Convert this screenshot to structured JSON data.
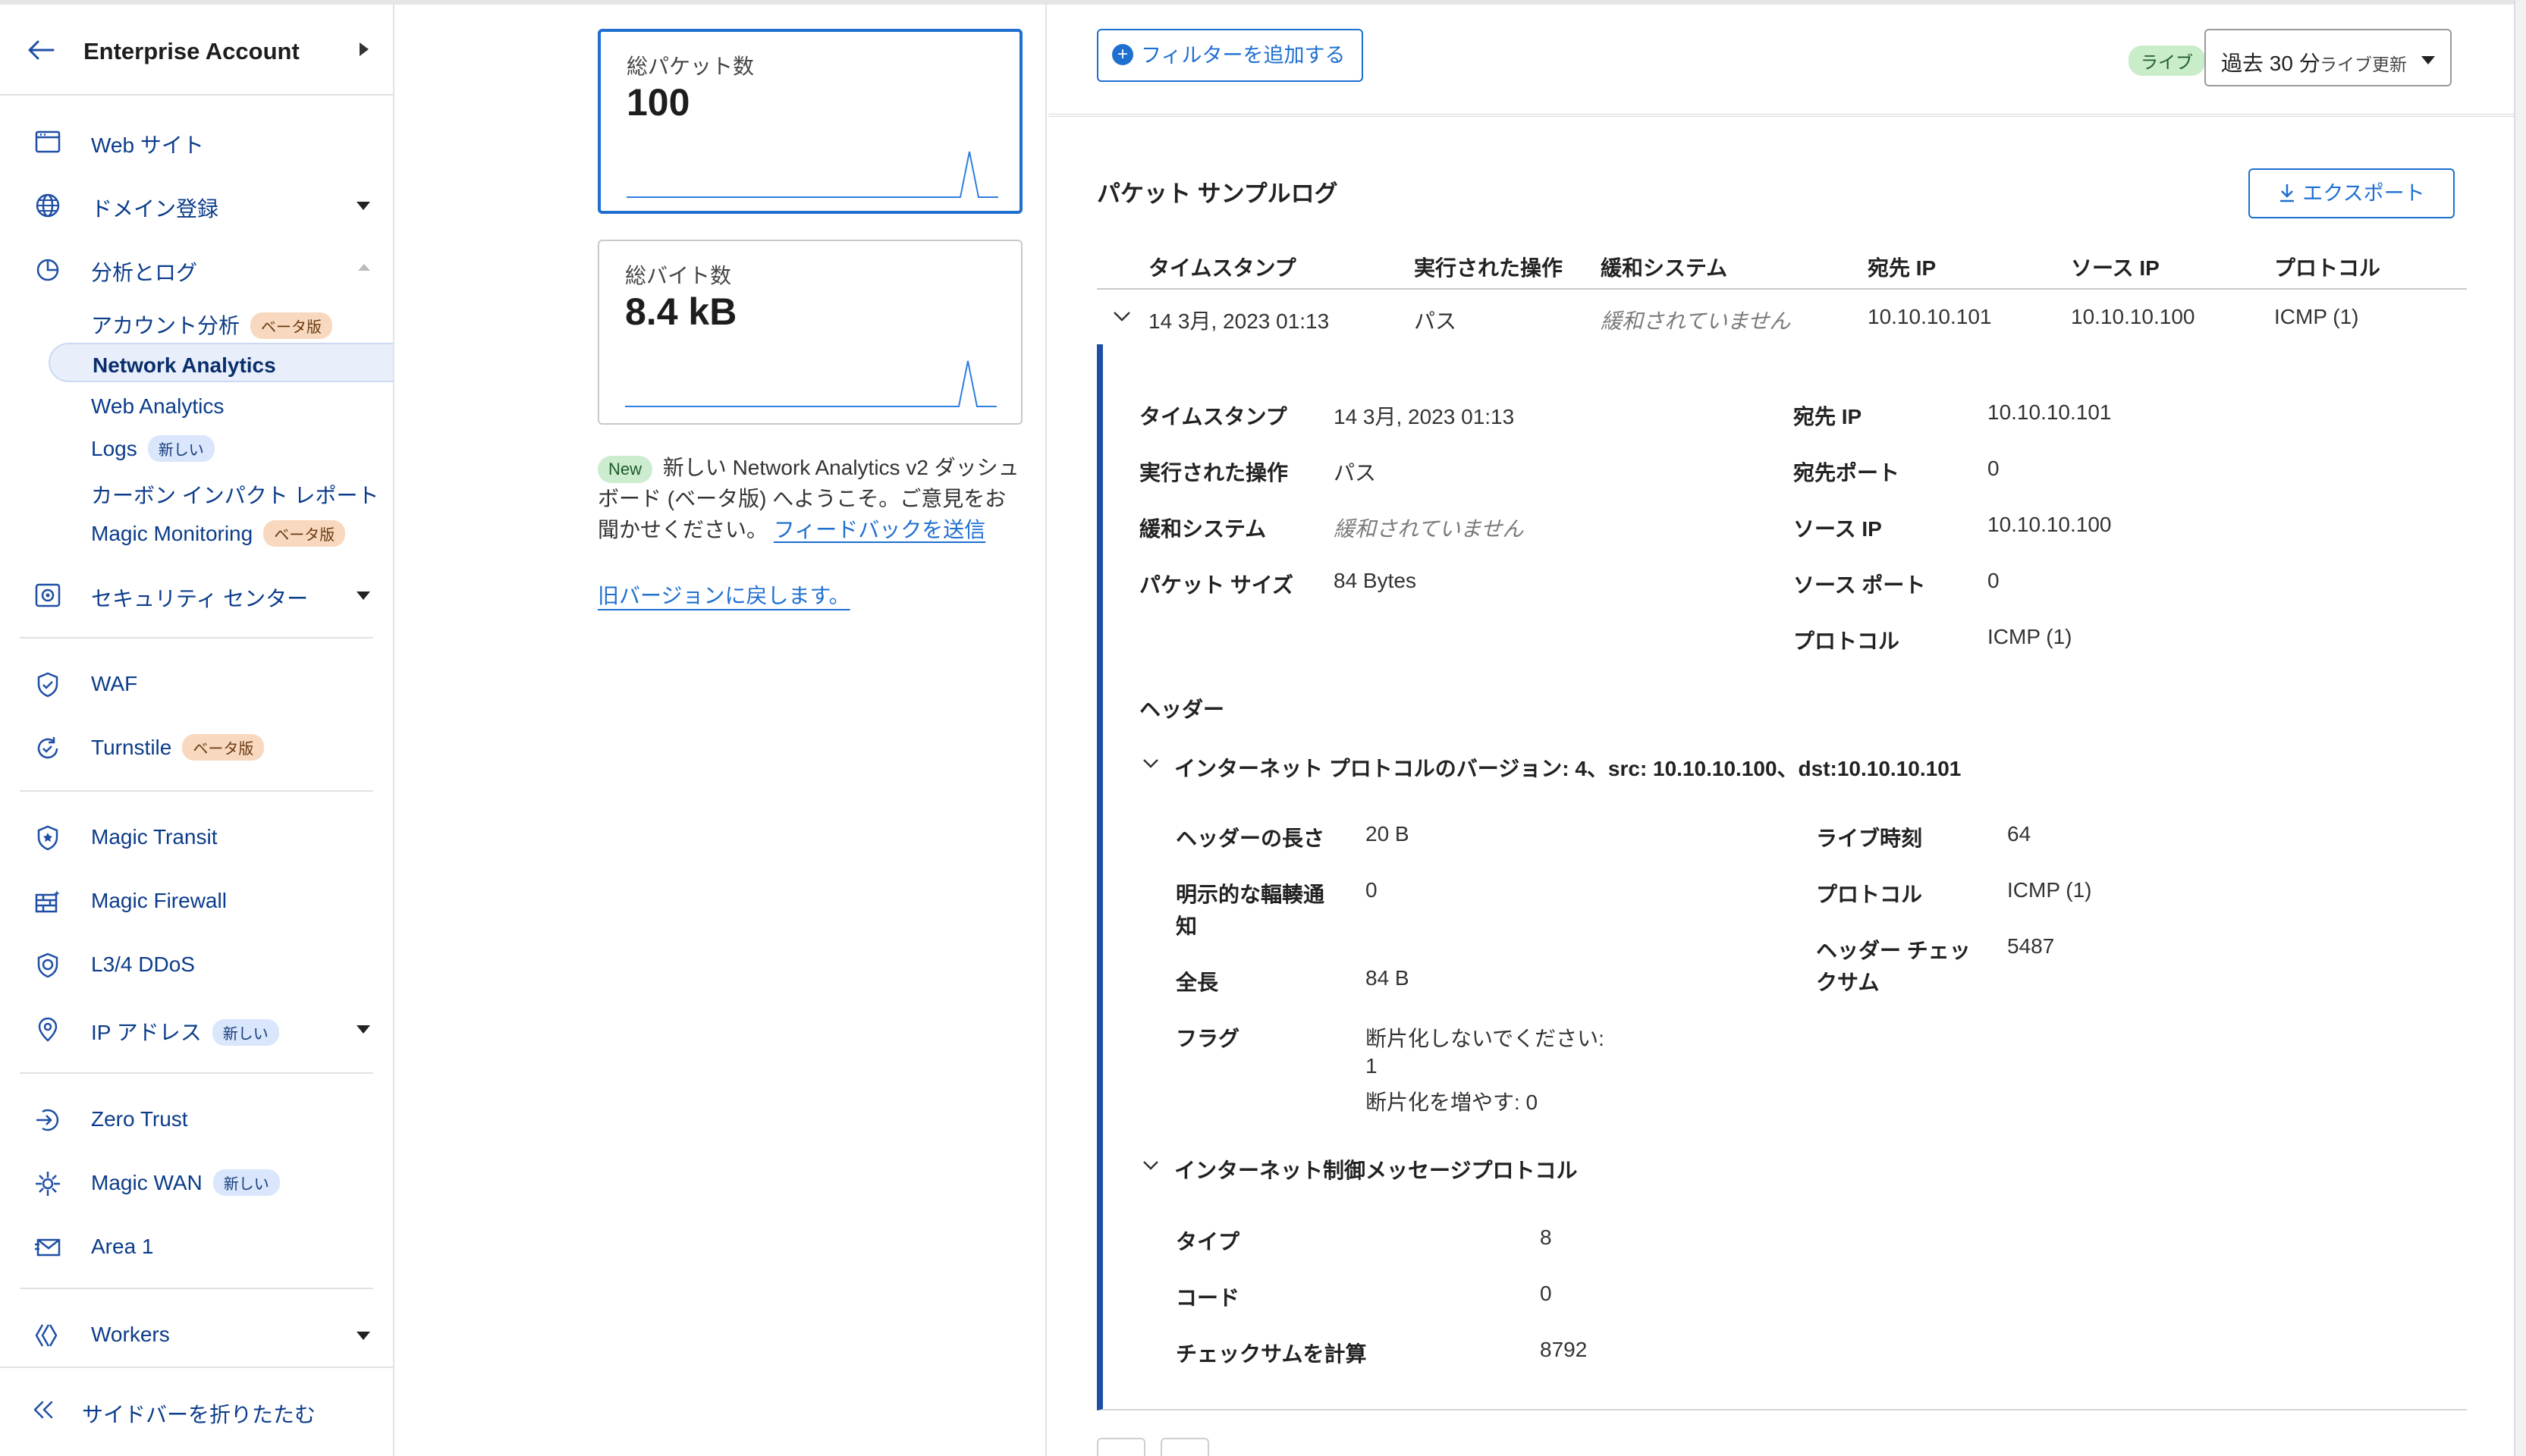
{
  "sidebar": {
    "account_title": "Enterprise Account",
    "items": {
      "websites": "Web サイト",
      "domain_registration": "ドメイン登録",
      "analytics_logs": "分析とログ",
      "account_analytics": "アカウント分析",
      "network_analytics": "Network Analytics",
      "web_analytics": "Web Analytics",
      "logs": "Logs",
      "carbon_report": "カーボン インパクト レポート",
      "magic_monitoring": "Magic Monitoring",
      "security_center": "セキュリティ センター",
      "waf": "WAF",
      "turnstile": "Turnstile",
      "magic_transit": "Magic Transit",
      "magic_firewall": "Magic Firewall",
      "l34_ddos": "L3/4 DDoS",
      "ip_addresses": "IP アドレス",
      "zero_trust": "Zero Trust",
      "magic_wan": "Magic WAN",
      "area1": "Area 1",
      "workers": "Workers"
    },
    "badges": {
      "beta": "ベータ版",
      "new": "新しい"
    },
    "collapse_label": "サイドバーを折りたたむ"
  },
  "summary": {
    "packets_label": "総パケット数",
    "packets_value": "100",
    "bytes_label": "総バイト数",
    "bytes_value": "8.4 kB",
    "promo_pill": "New",
    "promo_text": "新しい Network Analytics v2 ダッシュボード (ベータ版) へようこそ。ご意見をお聞かせください。",
    "feedback_link": "フィードバックを送信",
    "revert_link": "旧バージョンに戻します。"
  },
  "toolbar": {
    "add_filter": "フィルターを追加する",
    "live_badge": "ライブ",
    "time_range": "過去 30 分",
    "live_update": "ライブ更新"
  },
  "log": {
    "title": "パケット サンプルログ",
    "export": "エクスポート",
    "columns": [
      "タイムスタンプ",
      "実行された操作",
      "緩和システム",
      "宛先 IP",
      "ソース IP",
      "プロトコル"
    ],
    "row": {
      "timestamp": "14 3月, 2023 01:13",
      "action": "パス",
      "mitigation": "緩和されていません",
      "dest_ip": "10.10.10.101",
      "source_ip": "10.10.10.100",
      "protocol": "ICMP (1)"
    }
  },
  "details": {
    "timestamp_label": "タイムスタンプ",
    "timestamp_value": "14 3月, 2023 01:13",
    "action_label": "実行された操作",
    "action_value": "パス",
    "mitigation_label": "緩和システム",
    "mitigation_value": "緩和されていません",
    "packet_size_label": "パケット サイズ",
    "packet_size_value": "84 Bytes",
    "dest_ip_label": "宛先 IP",
    "dest_ip_value": "10.10.10.101",
    "dest_port_label": "宛先ポート",
    "dest_port_value": "0",
    "source_ip_label": "ソース IP",
    "source_ip_value": "10.10.10.100",
    "source_port_label": "ソース ポート",
    "source_port_value": "0",
    "protocol_label": "プロトコル",
    "protocol_value": "ICMP (1)",
    "headers_label": "ヘッダー",
    "ip_section_title": "インターネット プロトコルのバージョン: 4、src: 10.10.10.100、dst:10.10.10.101",
    "ip": {
      "header_length_label": "ヘッダーの長さ",
      "header_length_value": "20 B",
      "ecn_label_1": "明示的な輻輳通",
      "ecn_label_2": "知",
      "ecn_value": "0",
      "total_length_label": "全長",
      "total_length_value": "84 B",
      "flags_label": "フラグ",
      "flags_line1": "断片化しないでください:",
      "flags_line2": "1",
      "flags_line3": "断片化を増やす: 0",
      "ttl_label": "ライブ時刻",
      "ttl_value": "64",
      "protocol_label": "プロトコル",
      "protocol_value": "ICMP (1)",
      "checksum_label_1": "ヘッダー チェッ",
      "checksum_label_2": "クサム",
      "checksum_value": "5487"
    },
    "icmp_section_title": "インターネット制御メッセージプロトコル",
    "icmp": {
      "type_label": "タイプ",
      "type_value": "8",
      "code_label": "コード",
      "code_value": "0",
      "checksum_label": "チェックサムを計算",
      "checksum_value": "8792"
    }
  }
}
